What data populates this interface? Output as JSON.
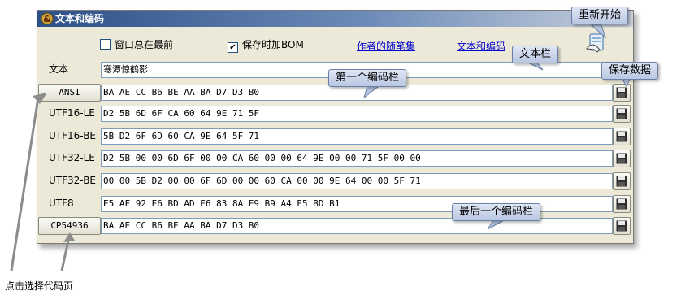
{
  "window": {
    "title": "文本和编码"
  },
  "options": {
    "topmost_label": "窗口总在最前",
    "topmost_checked": "",
    "bom_label": "保存时加BOM",
    "bom_checked": "✔"
  },
  "links": {
    "essays": "作者的随笔集",
    "text_encoding": "文本和编码"
  },
  "text_row": {
    "label": "文本",
    "value": "寒潭惊鹤影"
  },
  "encodings": [
    {
      "label": "ANSI",
      "is_button": true,
      "value": "BA AE CC B6 BE AA BA D7 D3 B0"
    },
    {
      "label": "UTF16-LE",
      "is_button": false,
      "value": "D2 5B 6D 6F CA 60 64 9E 71 5F"
    },
    {
      "label": "UTF16-BE",
      "is_button": false,
      "value": "5B D2 6F 6D 60 CA 9E 64 5F 71"
    },
    {
      "label": "UTF32-LE",
      "is_button": false,
      "value": "D2 5B 00 00 6D 6F 00 00 CA 60 00 00 64 9E 00 00 71 5F 00 00"
    },
    {
      "label": "UTF32-BE",
      "is_button": false,
      "value": "00 00 5B D2 00 00 6F 6D 00 00 60 CA 00 00 9E 64 00 00 5F 71"
    },
    {
      "label": "UTF8",
      "is_button": false,
      "value": "E5 AF 92 E6 BD AD E6 83 8A E9 B9 A4 E5 BD B1"
    },
    {
      "label": "CP54936",
      "is_button": true,
      "value": "BA AE CC B6 BE AA BA D7 D3 B0"
    }
  ],
  "callouts": {
    "restart": "重新开始",
    "text_bar": "文本栏",
    "save_data": "保存数据",
    "first_bar": "第一个编码栏",
    "last_bar": "最后一个编码栏",
    "choose_codepage": "点击选择代码页"
  },
  "icons": {
    "app": "app-logo-icon",
    "restart": "restart-hand-icon",
    "save": "floppy-disk-icon"
  },
  "colors": {
    "title_start": "#2c4f86",
    "title_end": "#c7cfdc",
    "face": "#ece9d8",
    "link": "#0000cc",
    "callout": "#c9d5ec"
  }
}
